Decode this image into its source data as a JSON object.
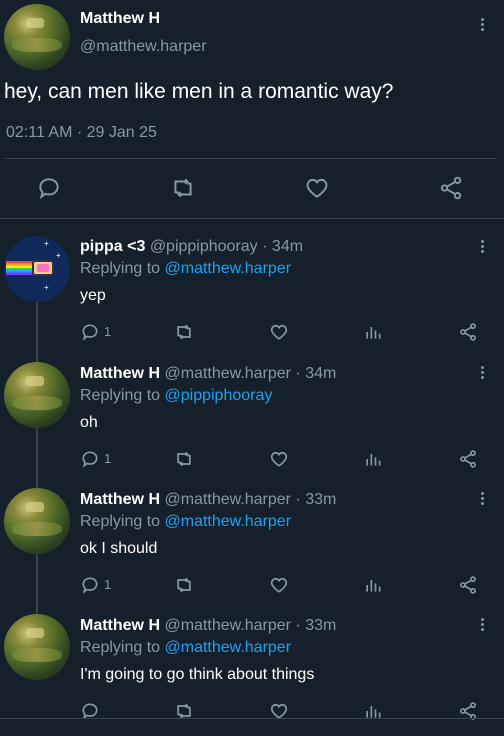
{
  "main": {
    "author_name": "Matthew H",
    "author_handle": "@matthew.harper",
    "text": "hey, can men like men in a romantic way?",
    "timestamp": "02:11 AM · 29 Jan 25",
    "actions": [
      "reply-icon",
      "retweet-icon",
      "like-icon",
      "share-icon"
    ]
  },
  "replies": [
    {
      "name": "pippa <3",
      "handle": "@pippiphooray",
      "age": "· 34m",
      "replying_prefix": "Replying to ",
      "replying_to": "@matthew.harper",
      "text": "yep",
      "reply_count": "1",
      "avatar": "nyan-cat"
    },
    {
      "name": "Matthew H",
      "handle": "@matthew.harper",
      "age": "· 34m",
      "replying_prefix": "Replying to ",
      "replying_to": "@pippiphooray",
      "text": "oh",
      "reply_count": "1",
      "avatar": "landscape"
    },
    {
      "name": "Matthew H",
      "handle": "@matthew.harper",
      "age": "· 33m",
      "replying_prefix": "Replying to ",
      "replying_to": "@matthew.harper",
      "text": "ok I should",
      "reply_count": "1",
      "avatar": "landscape"
    },
    {
      "name": "Matthew H",
      "handle": "@matthew.harper",
      "age": "· 33m",
      "replying_prefix": "Replying to ",
      "replying_to": "@matthew.harper",
      "text": "I'm going to go think about things",
      "reply_count": "",
      "avatar": "landscape"
    }
  ],
  "colors": {
    "background": "#15202b",
    "muted": "#8899a6",
    "link": "#1da1f2",
    "divider": "#38444d"
  }
}
